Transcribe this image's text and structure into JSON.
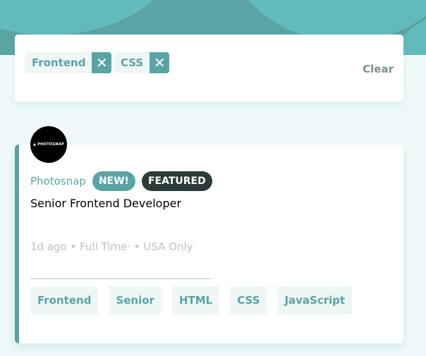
{
  "colors": {
    "primary": "#5ba4a4",
    "background": "#eff9f9",
    "tag_background": "#eff6f6",
    "featured": "#2c3a3a",
    "muted": "#b7c4c4"
  },
  "filters": {
    "items": [
      {
        "label": "Frontend",
        "remove_icon": "close-icon",
        "remove_glyph": "✕"
      },
      {
        "label": "CSS",
        "remove_icon": "close-icon",
        "remove_glyph": "✕"
      }
    ],
    "clear_label": "Clear"
  },
  "job": {
    "logo_text": "▲ PHOTOSNAP",
    "company": "Photosnap",
    "badges": {
      "new": "NEW!",
      "featured": "FEATURED"
    },
    "position": "Senior Frontend Developer",
    "details": "1d ago • Full Time· • USA Only",
    "tags": [
      "Frontend",
      "Senior",
      "HTML",
      "CSS",
      "JavaScript"
    ]
  }
}
